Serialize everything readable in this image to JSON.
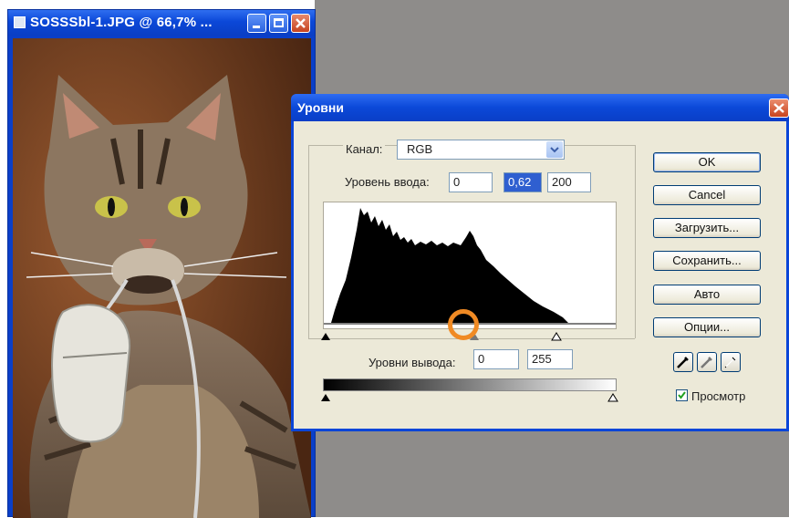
{
  "document_window": {
    "title": "SOSSSbl-1.JPG @ 66,7% ...",
    "photo_desc_icon": "cat-with-mouse-photo"
  },
  "levels_dialog": {
    "title": "Уровни",
    "channel_label": "Канал:",
    "channel_value": "RGB",
    "input_levels_label": "Уровень ввода:",
    "input_levels": [
      "0",
      "0,62",
      "200"
    ],
    "output_levels_label": "Уровни вывода:",
    "output_levels": [
      "0",
      "255"
    ],
    "buttons": {
      "ok": "OK",
      "cancel": "Cancel",
      "load": "Загрузить...",
      "save": "Сохранить...",
      "auto": "Авто",
      "options": "Опции..."
    },
    "eyedroppers": [
      "black-eyedropper-icon",
      "gray-eyedropper-icon",
      "white-eyedropper-icon"
    ],
    "preview_label": "Просмотр",
    "preview_checked": true
  },
  "highlight_color": "#f08a24"
}
